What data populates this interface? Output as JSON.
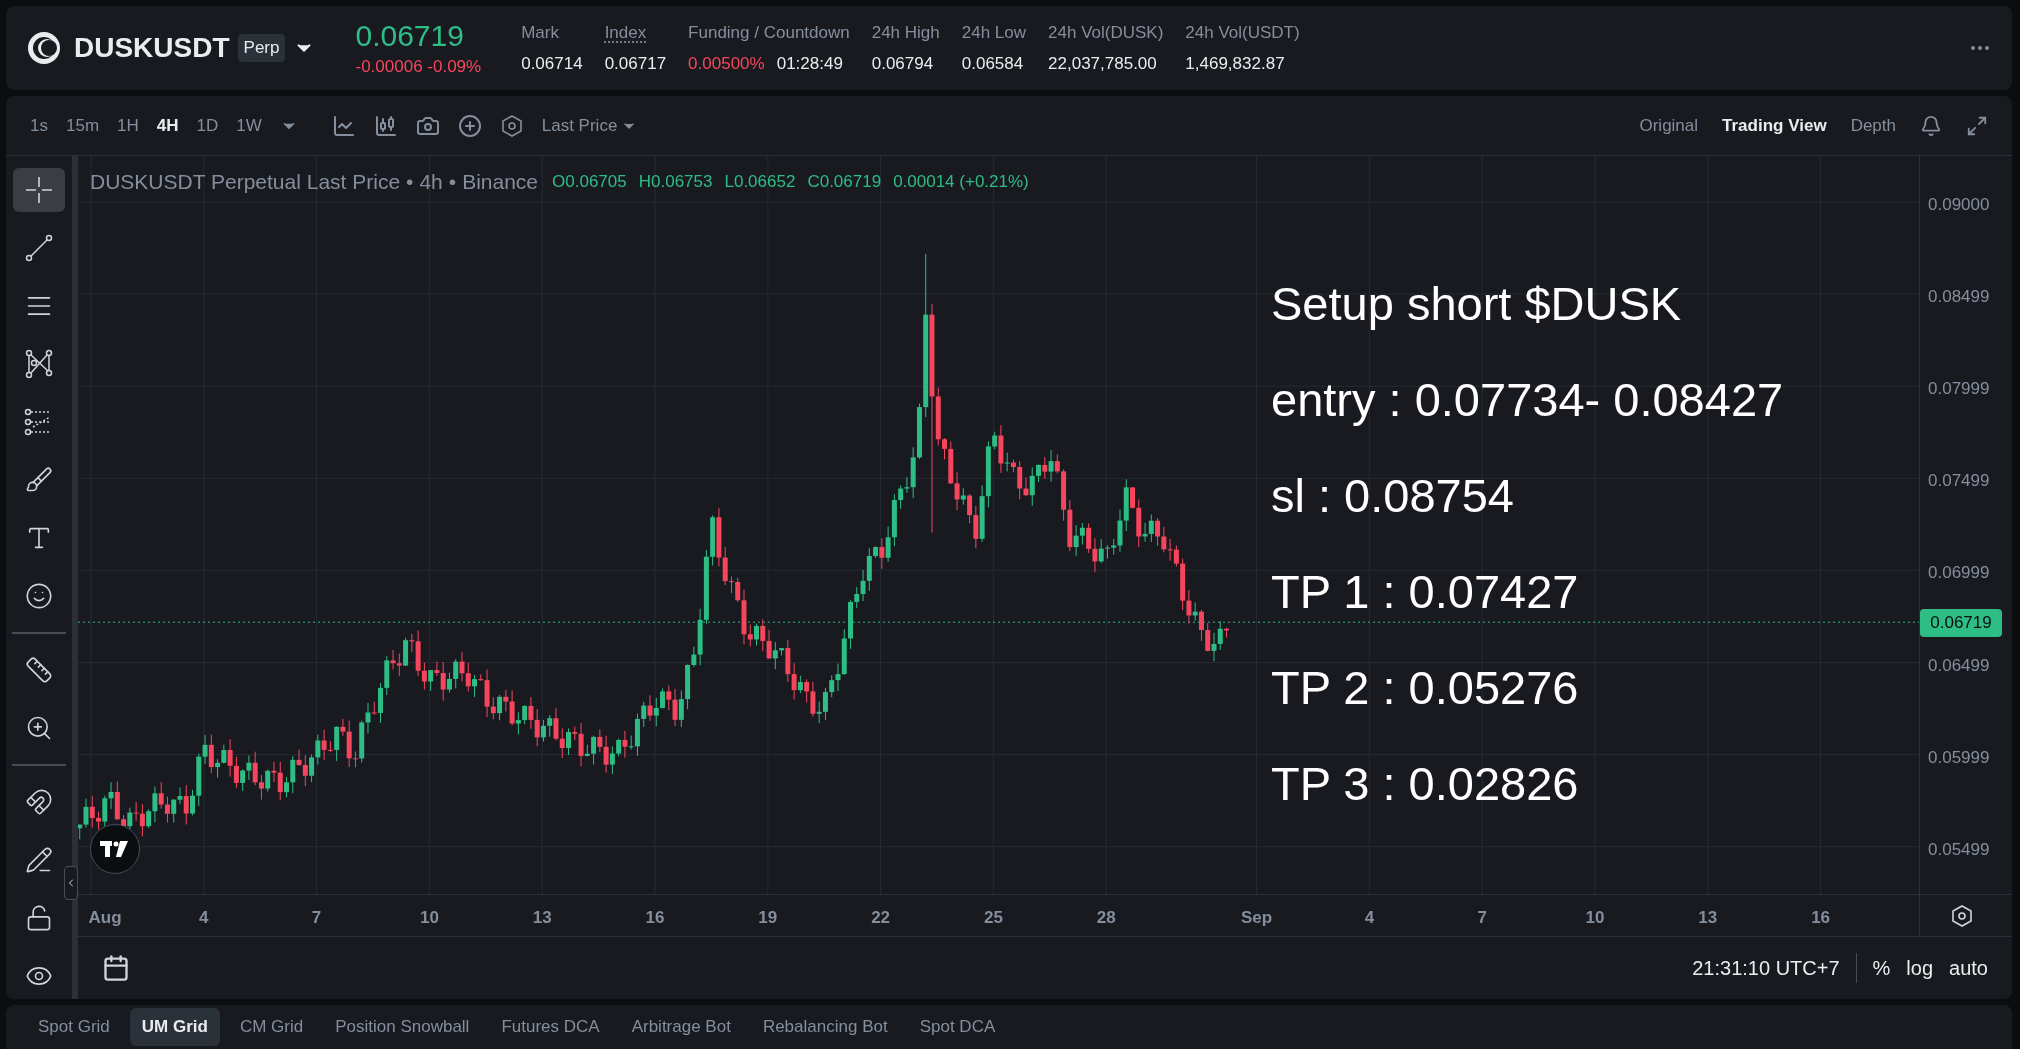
{
  "symbol": {
    "name": "DUSKUSDT",
    "badge": "Perp",
    "price": "0.06719",
    "change": "-0.00006 -0.09%"
  },
  "stats": [
    {
      "label": "Mark",
      "underlined": false,
      "values": [
        {
          "text": "0.06714",
          "kind": "neutral"
        }
      ]
    },
    {
      "label": "Index",
      "underlined": true,
      "values": [
        {
          "text": "0.06717",
          "kind": "neutral"
        }
      ]
    },
    {
      "label": "Funding / Countdown",
      "underlined": false,
      "values": [
        {
          "text": "0.00500%",
          "kind": "negative"
        },
        {
          "text": "01:28:49",
          "kind": "neutral"
        }
      ]
    },
    {
      "label": "24h High",
      "underlined": false,
      "values": [
        {
          "text": "0.06794",
          "kind": "neutral"
        }
      ]
    },
    {
      "label": "24h Low",
      "underlined": false,
      "values": [
        {
          "text": "0.06584",
          "kind": "neutral"
        }
      ]
    },
    {
      "label": "24h Vol(DUSK)",
      "underlined": false,
      "values": [
        {
          "text": "22,037,785.00",
          "kind": "neutral"
        }
      ]
    },
    {
      "label": "24h Vol(USDT)",
      "underlined": false,
      "values": [
        {
          "text": "1,469,832.87",
          "kind": "neutral"
        }
      ]
    }
  ],
  "intervals": [
    {
      "label": "1s",
      "selected": false
    },
    {
      "label": "15m",
      "selected": false
    },
    {
      "label": "1H",
      "selected": false
    },
    {
      "label": "4H",
      "selected": true
    },
    {
      "label": "1D",
      "selected": false
    },
    {
      "label": "1W",
      "selected": false
    }
  ],
  "price_type": "Last Price",
  "views": [
    {
      "label": "Original",
      "selected": false
    },
    {
      "label": "Trading View",
      "selected": true
    },
    {
      "label": "Depth",
      "selected": false
    }
  ],
  "tools": [
    {
      "kind": "crosshair",
      "selected": true
    },
    {
      "kind": "line",
      "selected": false
    },
    {
      "kind": "channels",
      "selected": false
    },
    {
      "kind": "pattern",
      "selected": false
    },
    {
      "kind": "fib",
      "selected": false
    },
    {
      "kind": "brush",
      "selected": false
    },
    {
      "kind": "text",
      "selected": false
    },
    {
      "kind": "emoji",
      "selected": false
    },
    {
      "kind": "ruler",
      "selected": false
    },
    {
      "kind": "zoom",
      "selected": false
    },
    {
      "kind": "magnet",
      "selected": false
    },
    {
      "kind": "lockdraw",
      "selected": false
    },
    {
      "kind": "lock",
      "selected": false
    },
    {
      "kind": "eye",
      "selected": false
    }
  ],
  "legend": {
    "parts": [
      "DUSKUSDT Perpetual Last Price",
      "•",
      "4h",
      "•",
      "Binance"
    ],
    "ohlc": [
      {
        "key": "O",
        "value": "0.06705"
      },
      {
        "key": "H",
        "value": "0.06753"
      },
      {
        "key": "L",
        "value": "0.06652"
      },
      {
        "key": "C",
        "value": "0.06719"
      }
    ],
    "change": "0.00014 (+0.21%)"
  },
  "annotations": [
    "Setup short $DUSK",
    "entry : 0.07734- 0.08427",
    "sl : 0.08754",
    "TP 1 : 0.07427",
    "TP 2 : 0.05276",
    "TP 3 : 0.02826"
  ],
  "price_axis": {
    "ticks": [
      "0.09000",
      "0.08499",
      "0.07999",
      "0.07499",
      "0.06999",
      "0.06499",
      "0.05999",
      "0.05499"
    ],
    "current": "0.06719"
  },
  "time_axis": [
    "Aug",
    "4",
    "7",
    "10",
    "13",
    "16",
    "19",
    "22",
    "25",
    "28",
    "Sep",
    "4",
    "7",
    "10",
    "13",
    "16"
  ],
  "footer": {
    "time": "21:31:10 UTC+7",
    "options": [
      "%",
      "log",
      "auto"
    ]
  },
  "bottom_tabs": [
    {
      "label": "Spot Grid",
      "selected": false
    },
    {
      "label": "UM Grid",
      "selected": true
    },
    {
      "label": "CM Grid",
      "selected": false
    },
    {
      "label": "Position Snowball",
      "selected": false
    },
    {
      "label": "Futures DCA",
      "selected": false
    },
    {
      "label": "Arbitrage Bot",
      "selected": false
    },
    {
      "label": "Rebalancing Bot",
      "selected": false
    },
    {
      "label": "Spot DCA",
      "selected": false
    }
  ]
}
